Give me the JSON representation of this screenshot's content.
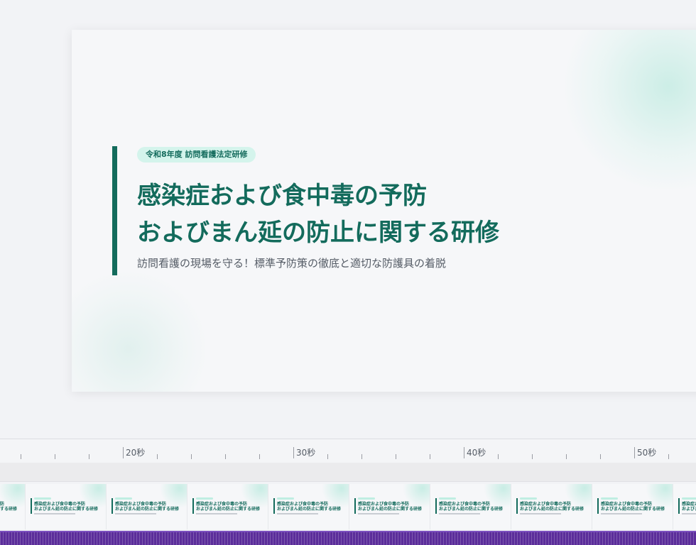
{
  "slide": {
    "badge": "令和8年度 訪問看護法定研修",
    "title_line1": "感染症および食中毒の予防",
    "title_line2": " およびまん延の防止に関する研修",
    "subtitle": "訪問看護の現場を守る！標準予防策の徹底と適切な防護具の着脱"
  },
  "timeline": {
    "markers": [
      "20秒",
      "30秒",
      "40秒",
      "50秒"
    ]
  },
  "colors": {
    "accent": "#136b5c",
    "badge_bg": "#d4f4ec",
    "audio_track": "#5b2d9a"
  }
}
